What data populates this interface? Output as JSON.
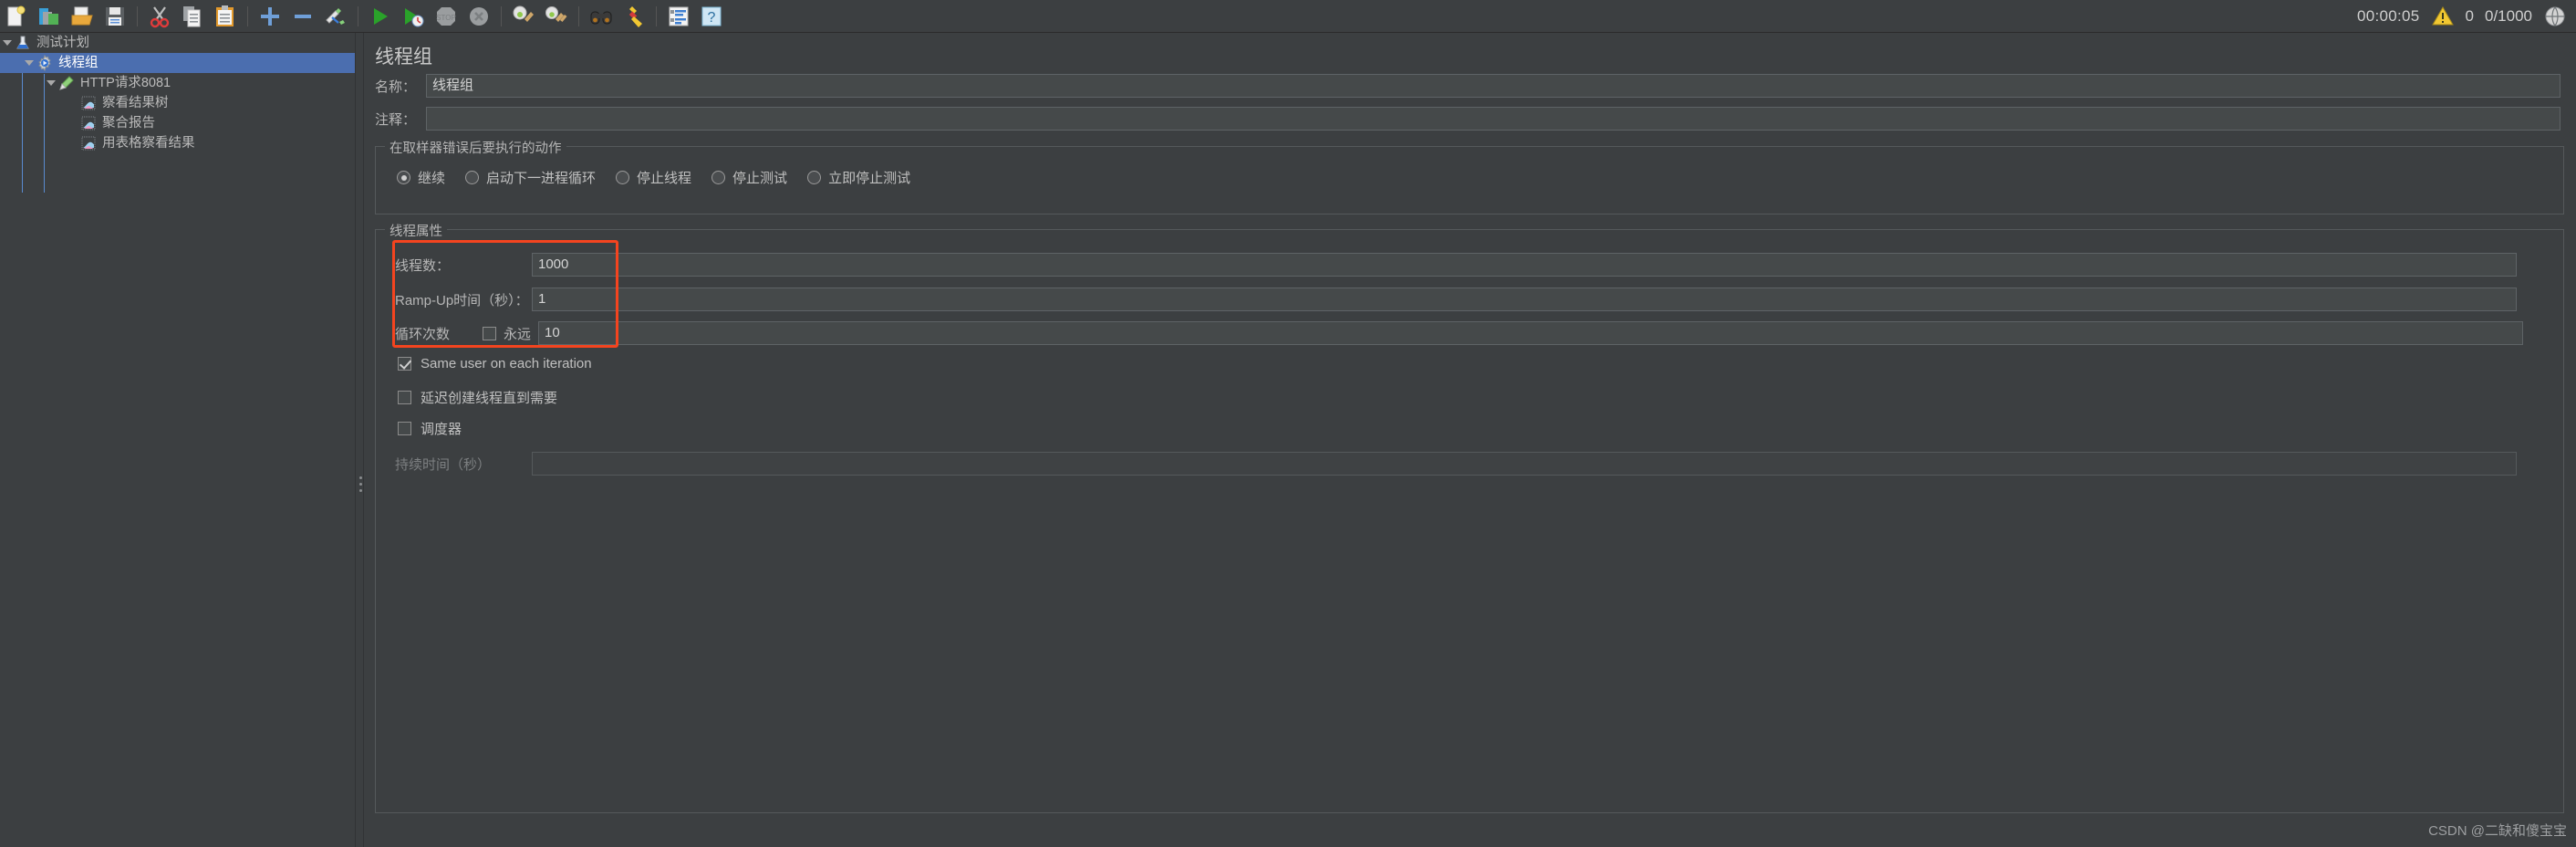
{
  "toolbar": {
    "buttons": [
      {
        "name": "new-test-plan",
        "icon": "new-document-icon"
      },
      {
        "name": "templates",
        "icon": "templates-icon"
      },
      {
        "name": "open",
        "icon": "open-folder-icon"
      },
      {
        "name": "save",
        "icon": "save-disk-icon"
      },
      {
        "name": "cut",
        "icon": "scissors-icon"
      },
      {
        "name": "copy",
        "icon": "copy-pages-icon"
      },
      {
        "name": "paste",
        "icon": "clipboard-icon"
      },
      {
        "name": "expand-all",
        "icon": "plus-icon"
      },
      {
        "name": "collapse-all",
        "icon": "minus-icon"
      },
      {
        "name": "toggle",
        "icon": "pencil-toggle-icon"
      },
      {
        "name": "start",
        "icon": "green-play-icon"
      },
      {
        "name": "start-no-timers",
        "icon": "green-play-clock-icon"
      },
      {
        "name": "stop",
        "icon": "stop-octagon-icon"
      },
      {
        "name": "shutdown",
        "icon": "shutdown-x-icon"
      },
      {
        "name": "clear",
        "icon": "broom-gear-icon"
      },
      {
        "name": "clear-all",
        "icon": "broom-gear-all-icon"
      },
      {
        "name": "search",
        "icon": "binoculars-icon"
      },
      {
        "name": "reset-search",
        "icon": "yellow-brush-icon"
      },
      {
        "name": "function-helper",
        "icon": "list-lines-icon"
      },
      {
        "name": "help",
        "icon": "help-question-icon"
      }
    ],
    "timer": "00:00:05",
    "warning_count": "0",
    "thread_count": "0/1000",
    "warning_icon": "warning-triangle-icon",
    "globe_icon": "globe-icon"
  },
  "tree": {
    "items": [
      {
        "label": "测试计划",
        "icon": "test-plan-flask-icon",
        "depth": 0,
        "expanded": true,
        "selected": false
      },
      {
        "label": "线程组",
        "icon": "thread-group-gear-icon",
        "depth": 1,
        "expanded": true,
        "selected": true
      },
      {
        "label": "HTTP请求8081",
        "icon": "http-sampler-pen-icon",
        "depth": 2,
        "expanded": true,
        "selected": false
      },
      {
        "label": "察看结果树",
        "icon": "listener-chart-icon",
        "depth": 3,
        "expanded": false,
        "selected": false
      },
      {
        "label": "聚合报告",
        "icon": "listener-chart-icon",
        "depth": 3,
        "expanded": false,
        "selected": false
      },
      {
        "label": "用表格察看结果",
        "icon": "listener-chart-icon",
        "depth": 3,
        "expanded": false,
        "selected": false
      }
    ]
  },
  "panel": {
    "title": "线程组",
    "name_label": "名称：",
    "name_value": "线程组",
    "comment_label": "注释：",
    "comment_value": "",
    "error_action": {
      "group_title": "在取样器错误后要执行的动作",
      "options": [
        {
          "label": "继续",
          "selected": true
        },
        {
          "label": "启动下一进程循环",
          "selected": false
        },
        {
          "label": "停止线程",
          "selected": false
        },
        {
          "label": "停止测试",
          "selected": false
        },
        {
          "label": "立即停止测试",
          "selected": false
        }
      ]
    },
    "thread_properties": {
      "group_title": "线程属性",
      "threads_label": "线程数：",
      "threads_value": "1000",
      "rampup_label": "Ramp-Up时间（秒）：",
      "rampup_value": "1",
      "loops_label": "循环次数",
      "forever_label": "永远",
      "forever_checked": false,
      "loops_value": "10",
      "highlight_color": "#f4441f"
    },
    "checkboxes": [
      {
        "label": "Same user on each iteration",
        "checked": true
      },
      {
        "label": "延迟创建线程直到需要",
        "checked": false
      },
      {
        "label": "调度器",
        "checked": false
      }
    ],
    "duration_label": "持续时间（秒）",
    "duration_value": ""
  },
  "watermark": "CSDN @二缺和傻宝宝"
}
